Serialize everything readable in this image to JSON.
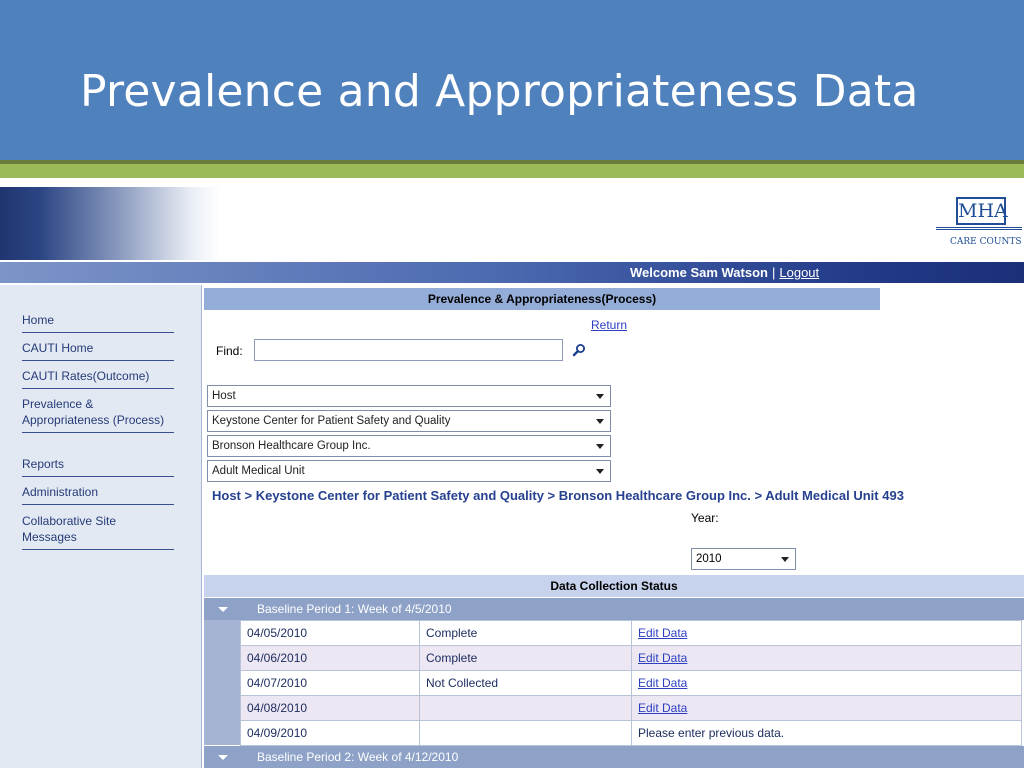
{
  "slide": {
    "title": "Prevalence and Appropriateness Data"
  },
  "colors": {
    "slide_header": "#4f81bd",
    "accent_green": "#9bbb59",
    "page_head": "#94add8",
    "period_bar": "#8ea2c8",
    "link": "#2b3fc0"
  },
  "logo": {
    "mark": "MHA",
    "tagline": "CARE COUNTS"
  },
  "header": {
    "welcome": "Welcome Sam Watson",
    "separator": "|",
    "logout": "Logout"
  },
  "sidebar": {
    "items": [
      {
        "label": "Home"
      },
      {
        "label": "CAUTI Home"
      },
      {
        "label": "CAUTI Rates(Outcome)"
      },
      {
        "label": "Prevalence & Appropriateness (Process)"
      },
      {
        "label": "Reports"
      },
      {
        "label": "Administration"
      },
      {
        "label": "Collaborative Site Messages"
      }
    ]
  },
  "main": {
    "title": "Prevalence & Appropriateness(Process)",
    "return": "Return",
    "find": {
      "label": "Find:",
      "value": "",
      "placeholder": ""
    },
    "selects": [
      {
        "value": "Host"
      },
      {
        "value": "Keystone Center for Patient Safety and Quality"
      },
      {
        "value": "Bronson Healthcare Group Inc."
      },
      {
        "value": "Adult Medical Unit"
      }
    ],
    "breadcrumb": "Host > Keystone Center for Patient Safety and Quality > Bronson Healthcare Group Inc. > Adult Medical Unit 493",
    "year": {
      "label": "Year:",
      "value": "2010"
    },
    "status_header": "Data Collection Status",
    "periods": [
      {
        "label": "Baseline Period 1: Week of 4/5/2010",
        "rows": [
          {
            "date": "04/05/2010",
            "status": "Complete",
            "action": "Edit Data"
          },
          {
            "date": "04/06/2010",
            "status": "Complete",
            "action": "Edit Data"
          },
          {
            "date": "04/07/2010",
            "status": "Not Collected",
            "action": "Edit Data"
          },
          {
            "date": "04/08/2010",
            "status": "",
            "action": "Edit Data"
          },
          {
            "date": "04/09/2010",
            "status": "",
            "action": "Please enter previous data."
          }
        ]
      },
      {
        "label": "Baseline Period 2: Week of 4/12/2010",
        "rows": []
      }
    ]
  }
}
